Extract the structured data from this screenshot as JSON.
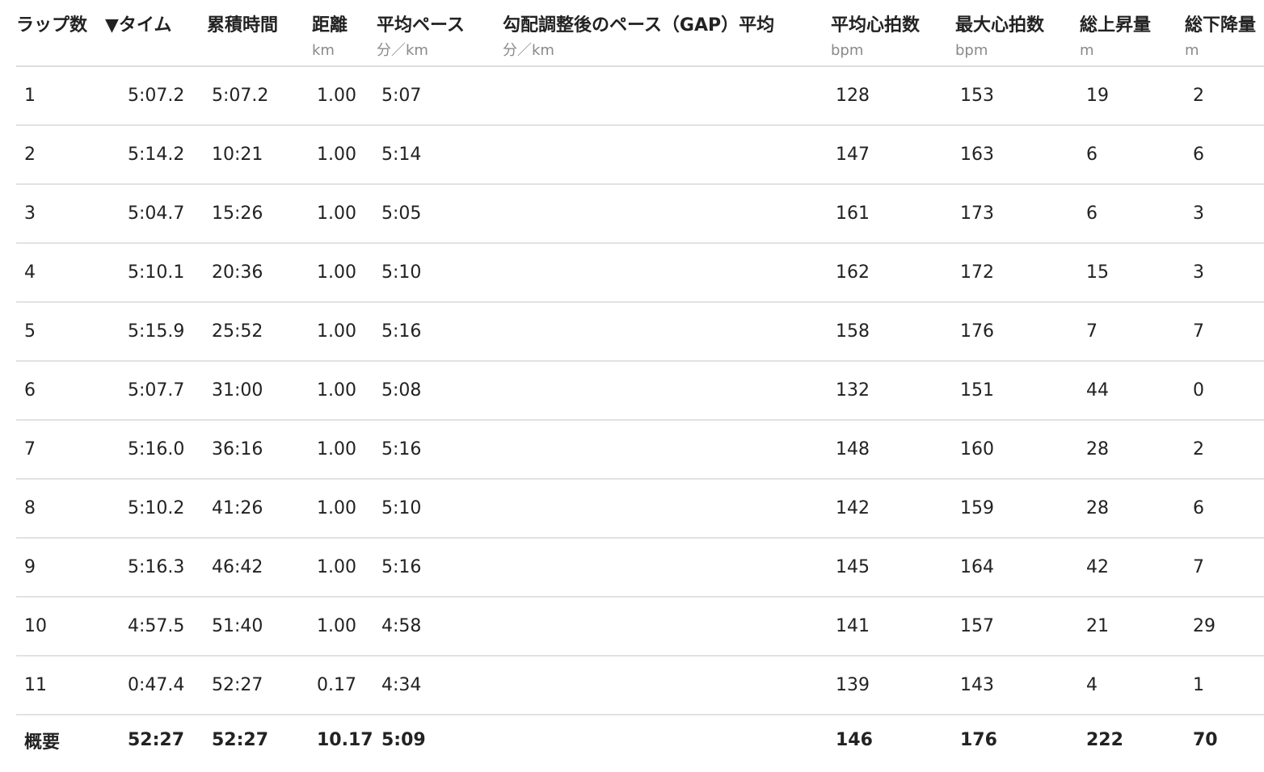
{
  "headers": [
    {
      "title": "ラップ数",
      "unit": ""
    },
    {
      "title": "▼タイム",
      "unit": ""
    },
    {
      "title": "累積時間",
      "unit": ""
    },
    {
      "title": "距離",
      "unit": "km"
    },
    {
      "title": "平均ペース",
      "unit": "分／km"
    },
    {
      "title": "勾配調整後のペース（GAP）平均",
      "unit": "分／km"
    },
    {
      "title": "平均心拍数",
      "unit": "bpm"
    },
    {
      "title": "最大心拍数",
      "unit": "bpm"
    },
    {
      "title": "総上昇量",
      "unit": "m"
    },
    {
      "title": "総下降量",
      "unit": "m"
    }
  ],
  "rows": [
    {
      "lap": "1",
      "time": "5:07.2",
      "total": "5:07.2",
      "dist": "1.00",
      "pace": "5:07",
      "gap": "",
      "hr": "128",
      "max_hr": "153",
      "gain": "19",
      "loss": "2"
    },
    {
      "lap": "2",
      "time": "5:14.2",
      "total": "10:21",
      "dist": "1.00",
      "pace": "5:14",
      "gap": "",
      "hr": "147",
      "max_hr": "163",
      "gain": "6",
      "loss": "6"
    },
    {
      "lap": "3",
      "time": "5:04.7",
      "total": "15:26",
      "dist": "1.00",
      "pace": "5:05",
      "gap": "",
      "hr": "161",
      "max_hr": "173",
      "gain": "6",
      "loss": "3"
    },
    {
      "lap": "4",
      "time": "5:10.1",
      "total": "20:36",
      "dist": "1.00",
      "pace": "5:10",
      "gap": "",
      "hr": "162",
      "max_hr": "172",
      "gain": "15",
      "loss": "3"
    },
    {
      "lap": "5",
      "time": "5:15.9",
      "total": "25:52",
      "dist": "1.00",
      "pace": "5:16",
      "gap": "",
      "hr": "158",
      "max_hr": "176",
      "gain": "7",
      "loss": "7"
    },
    {
      "lap": "6",
      "time": "5:07.7",
      "total": "31:00",
      "dist": "1.00",
      "pace": "5:08",
      "gap": "",
      "hr": "132",
      "max_hr": "151",
      "gain": "44",
      "loss": "0"
    },
    {
      "lap": "7",
      "time": "5:16.0",
      "total": "36:16",
      "dist": "1.00",
      "pace": "5:16",
      "gap": "",
      "hr": "148",
      "max_hr": "160",
      "gain": "28",
      "loss": "2"
    },
    {
      "lap": "8",
      "time": "5:10.2",
      "total": "41:26",
      "dist": "1.00",
      "pace": "5:10",
      "gap": "",
      "hr": "142",
      "max_hr": "159",
      "gain": "28",
      "loss": "6"
    },
    {
      "lap": "9",
      "time": "5:16.3",
      "total": "46:42",
      "dist": "1.00",
      "pace": "5:16",
      "gap": "",
      "hr": "145",
      "max_hr": "164",
      "gain": "42",
      "loss": "7"
    },
    {
      "lap": "10",
      "time": "4:57.5",
      "total": "51:40",
      "dist": "1.00",
      "pace": "4:58",
      "gap": "",
      "hr": "141",
      "max_hr": "157",
      "gain": "21",
      "loss": "29"
    },
    {
      "lap": "11",
      "time": "0:47.4",
      "total": "52:27",
      "dist": "0.17",
      "pace": "4:34",
      "gap": "",
      "hr": "139",
      "max_hr": "143",
      "gain": "4",
      "loss": "1"
    }
  ],
  "summary": {
    "lap": "概要",
    "time": "52:27",
    "total": "52:27",
    "dist": "10.17",
    "pace": "5:09",
    "gap": "",
    "hr": "146",
    "max_hr": "176",
    "gain": "222",
    "loss": "70"
  }
}
